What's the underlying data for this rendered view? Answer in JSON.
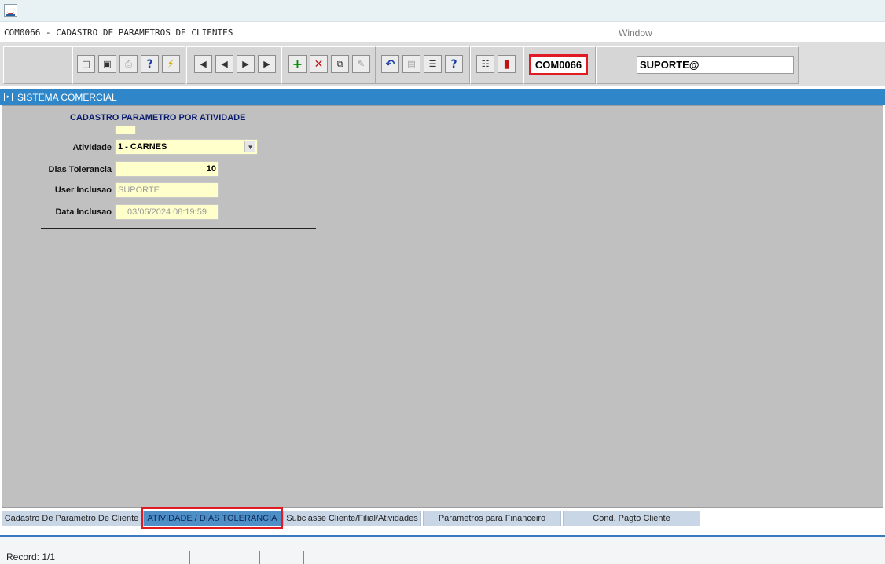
{
  "window": {
    "title": "COM0066 - CADASTRO DE PARAMETROS DE CLIENTES",
    "menu_window": "Window"
  },
  "toolbar": {
    "buttons": [
      {
        "name": "save-icon",
        "glyph": "💾"
      },
      {
        "name": "screen-icon",
        "glyph": "▣"
      },
      {
        "name": "print-icon",
        "glyph": "⎙"
      },
      {
        "name": "help-query-icon",
        "glyph": "?"
      },
      {
        "name": "execute-query-icon",
        "glyph": "⚡"
      },
      {
        "name": "first-record-icon",
        "glyph": "⏮"
      },
      {
        "name": "previous-record-icon",
        "glyph": "◀"
      },
      {
        "name": "next-record-icon",
        "glyph": "▶"
      },
      {
        "name": "last-record-icon",
        "glyph": "⏭"
      },
      {
        "name": "insert-record-icon",
        "glyph": "+"
      },
      {
        "name": "delete-record-icon",
        "glyph": "✕"
      },
      {
        "name": "duplicate-record-icon",
        "glyph": "⧉"
      },
      {
        "name": "edit-icon",
        "glyph": "✎"
      },
      {
        "name": "undo-icon",
        "glyph": "↶"
      },
      {
        "name": "clipboard-icon",
        "glyph": "📋"
      },
      {
        "name": "list-values-icon",
        "glyph": "☰"
      },
      {
        "name": "help-icon",
        "glyph": "?"
      },
      {
        "name": "menu-icon",
        "glyph": "☷"
      },
      {
        "name": "exit-icon",
        "glyph": "→"
      }
    ],
    "form_code": "COM0066",
    "user": "SUPORTE@"
  },
  "section": {
    "title": "SISTEMA COMERCIAL"
  },
  "form": {
    "heading": "CADASTRO PARAMETRO POR ATIVIDADE",
    "atividade_label": "Atividade",
    "atividade_value": "1 - CARNES",
    "dias_label": "Dias Tolerancia",
    "dias_value": "10",
    "user_label": "User Inclusao",
    "user_value": "SUPORTE",
    "data_label": "Data Inclusao",
    "data_value": "03/06/2024 08:19:59"
  },
  "tabs": [
    {
      "label": "Cadastro De Parametro De Cliente",
      "active": false
    },
    {
      "label": "ATIVIDADE / DIAS TOLERANCIA",
      "active": true
    },
    {
      "label": "Subclasse Cliente/Filial/Atividades",
      "active": false
    },
    {
      "label": "Parametros para Financeiro",
      "active": false
    },
    {
      "label": "Cond. Pagto Cliente",
      "active": false
    }
  ],
  "status": {
    "record": "Record: 1/1"
  }
}
